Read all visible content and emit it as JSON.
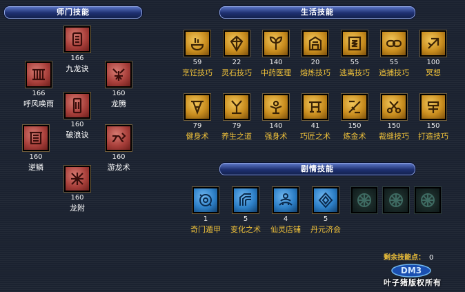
{
  "sections": {
    "school": "师门技能",
    "life": "生活技能",
    "story": "剧情技能"
  },
  "school_skills": [
    {
      "name": "九龙诀",
      "level": "166",
      "icon": "scroll-icon"
    },
    {
      "name": "呼风唤雨",
      "level": "166",
      "icon": "storm-icon"
    },
    {
      "name": "龙腾",
      "level": "160",
      "icon": "dragon-icon"
    },
    {
      "name": "破浪诀",
      "level": "160",
      "icon": "wave-icon"
    },
    {
      "name": "逆鳞",
      "level": "160",
      "icon": "scale-icon"
    },
    {
      "name": "游龙术",
      "level": "160",
      "icon": "serpent-icon"
    },
    {
      "name": "龙附",
      "level": "160",
      "icon": "claw-icon"
    }
  ],
  "life_skills": [
    {
      "name": "烹饪技巧",
      "level": "59",
      "icon": "cooking-icon"
    },
    {
      "name": "灵石技巧",
      "level": "22",
      "icon": "gem-icon"
    },
    {
      "name": "中药医理",
      "level": "140",
      "icon": "herb-icon"
    },
    {
      "name": "熔炼技巧",
      "level": "20",
      "icon": "furnace-icon"
    },
    {
      "name": "逃离技巧",
      "level": "55",
      "icon": "escape-icon"
    },
    {
      "name": "追捕技巧",
      "level": "55",
      "icon": "chain-icon"
    },
    {
      "name": "冥想",
      "level": "100",
      "icon": "meditate-icon"
    },
    {
      "name": "健身术",
      "level": "79",
      "icon": "fitness-icon"
    },
    {
      "name": "养生之道",
      "level": "79",
      "icon": "health-icon"
    },
    {
      "name": "强身术",
      "level": "140",
      "icon": "strength-icon"
    },
    {
      "name": "巧匠之术",
      "level": "41",
      "icon": "craft-icon"
    },
    {
      "name": "炼金术",
      "level": "150",
      "icon": "alchemy-icon"
    },
    {
      "name": "裁缝技巧",
      "level": "150",
      "icon": "scissors-icon"
    },
    {
      "name": "打造技巧",
      "level": "150",
      "icon": "hammer-icon"
    }
  ],
  "story_skills": [
    {
      "name": "奇门遁甲",
      "level": "1",
      "icon": "portal-icon"
    },
    {
      "name": "变化之术",
      "level": "5",
      "icon": "transform-icon"
    },
    {
      "name": "仙灵店铺",
      "level": "4",
      "icon": "shop-icon"
    },
    {
      "name": "丹元济会",
      "level": "5",
      "icon": "elixir-icon"
    },
    {
      "name": "",
      "level": "",
      "icon": "locked-emblem-icon",
      "locked": true
    },
    {
      "name": "",
      "level": "",
      "icon": "locked-emblem-icon",
      "locked": true
    },
    {
      "name": "",
      "level": "",
      "icon": "locked-emblem-icon",
      "locked": true
    }
  ],
  "remaining_points": {
    "label": "剩余技能点：",
    "value": "0"
  },
  "watermark": {
    "logo": "DM3",
    "text": "叶子猪版权所有"
  },
  "colors": {
    "header": "#1e3070",
    "skill_name_white": "#ffffff",
    "skill_name_yellow": "#f0c23a",
    "points": "#f0c23a"
  }
}
